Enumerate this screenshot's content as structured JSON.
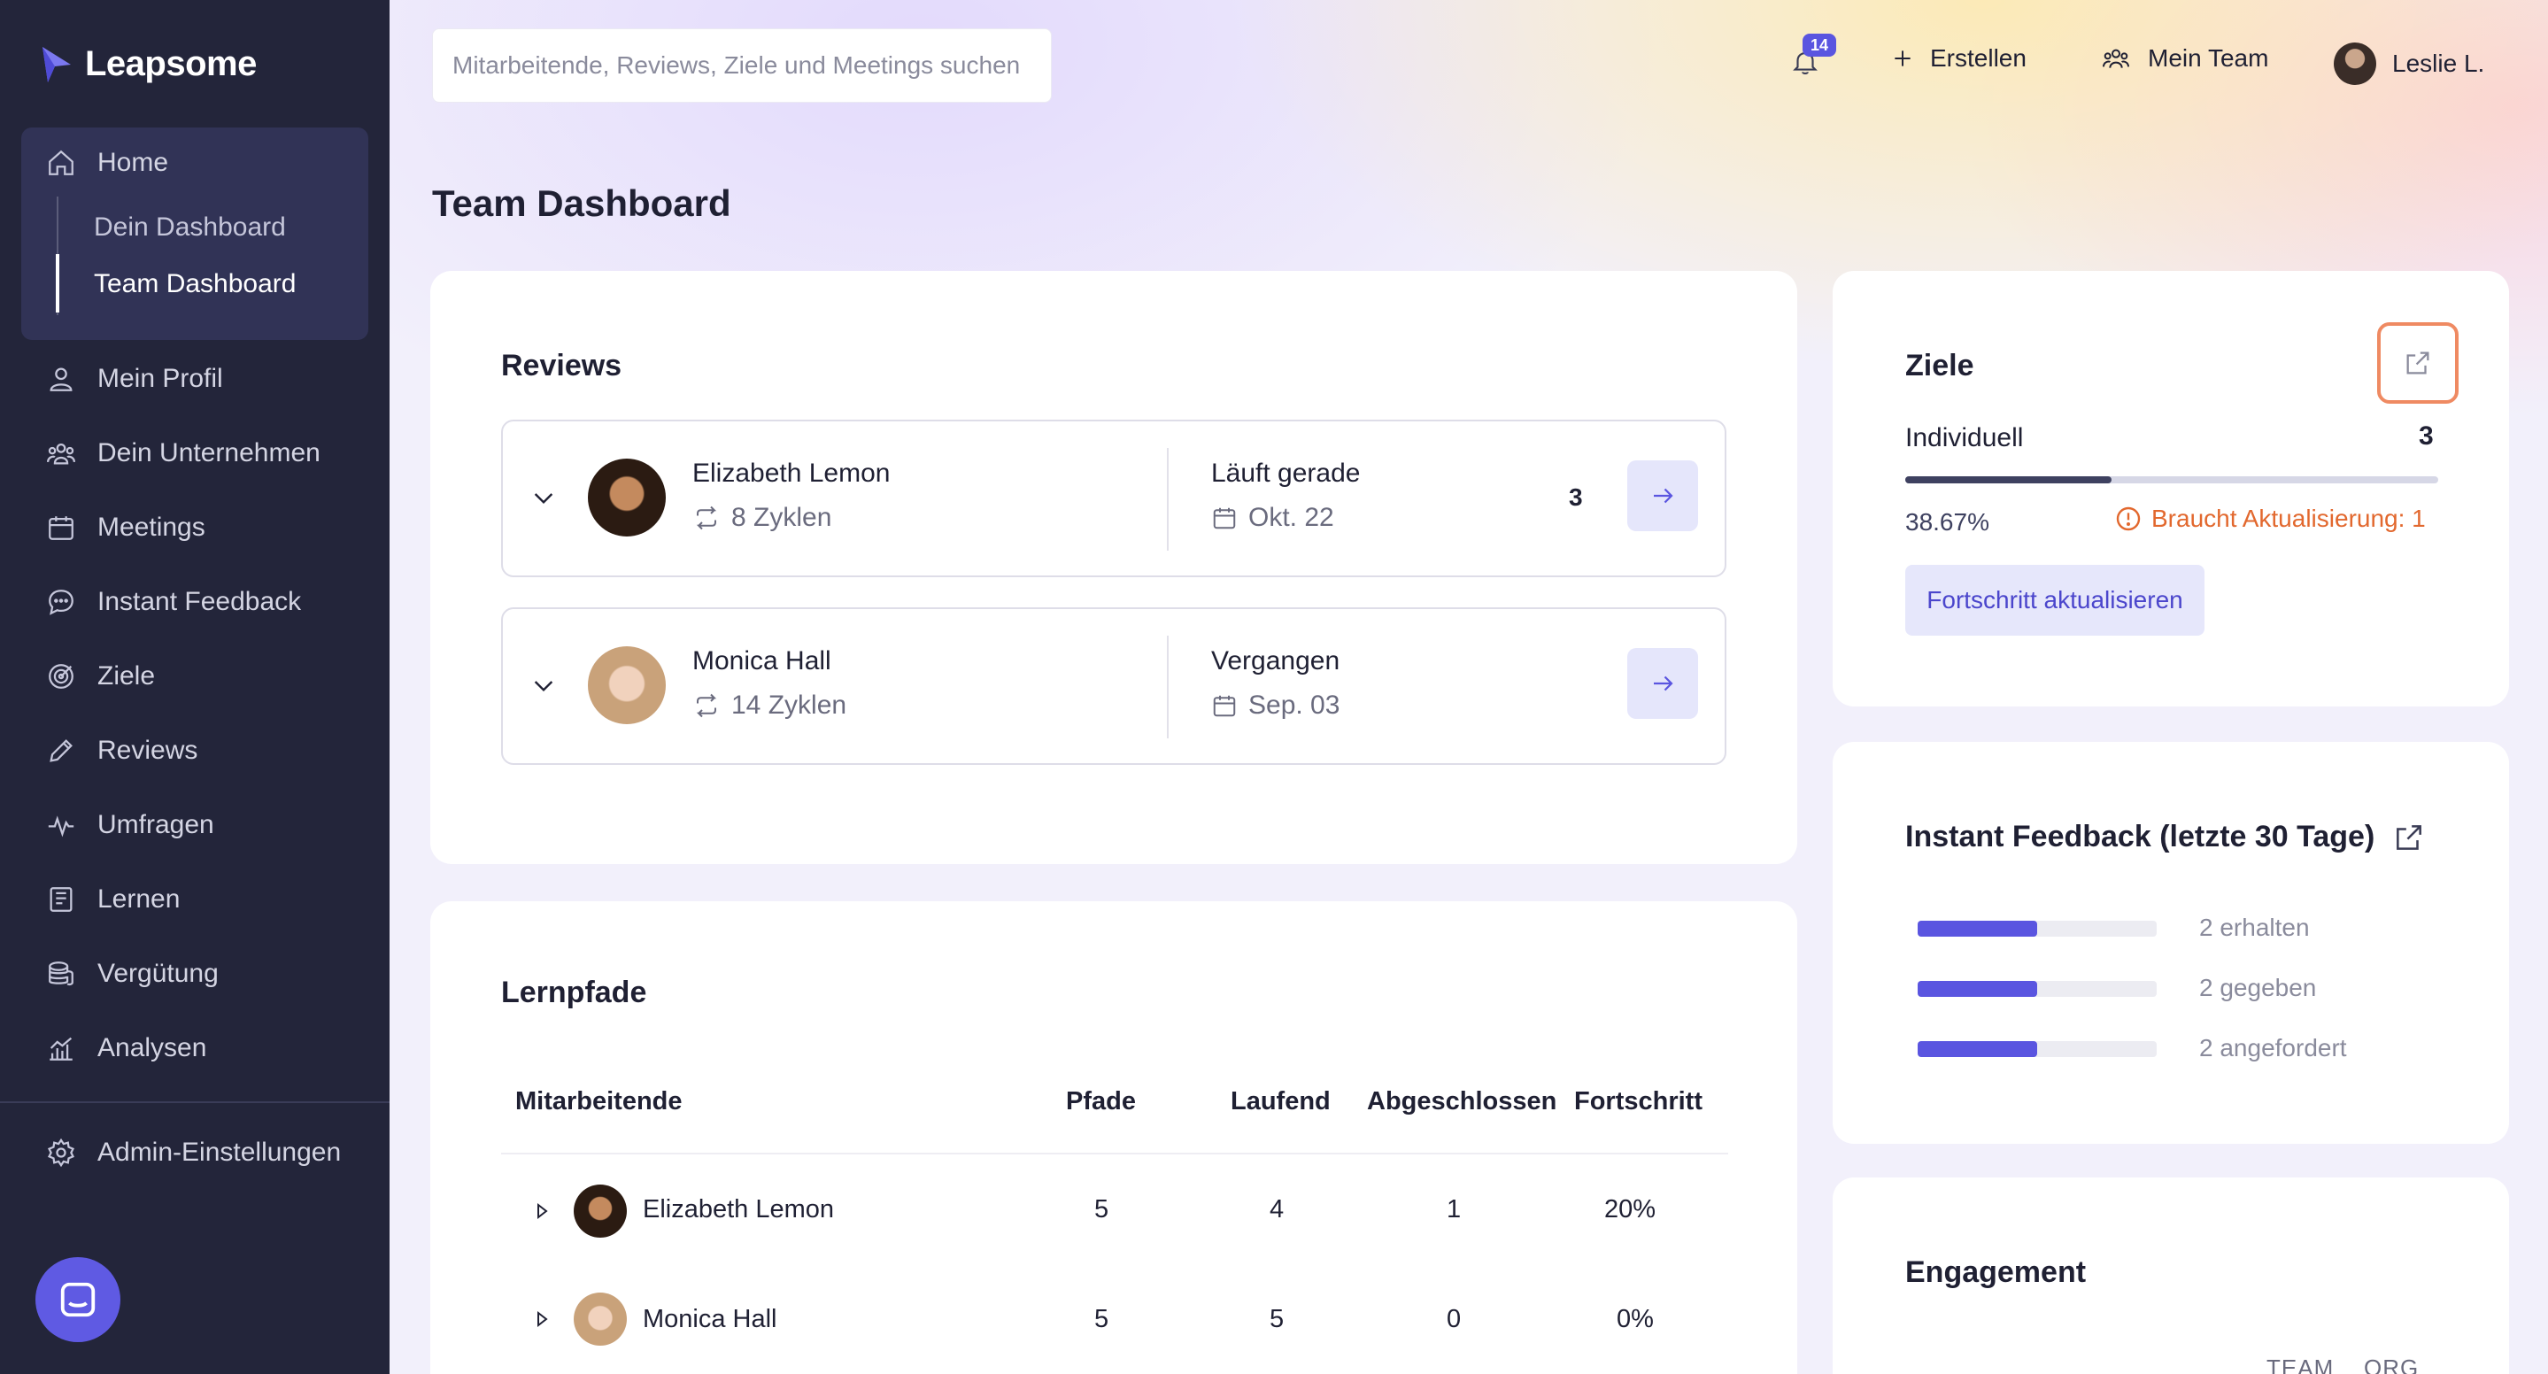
{
  "app": {
    "logo_text": "Leapsome"
  },
  "sidebar": {
    "home_label": "Home",
    "sub_items": [
      {
        "label": "Dein Dashboard"
      },
      {
        "label": "Team Dashboard"
      }
    ],
    "items": [
      {
        "label": "Mein Profil",
        "icon": "user-icon"
      },
      {
        "label": "Dein Unternehmen",
        "icon": "users-icon"
      },
      {
        "label": "Meetings",
        "icon": "calendar-icon"
      },
      {
        "label": "Instant Feedback",
        "icon": "chat-icon"
      },
      {
        "label": "Ziele",
        "icon": "target-icon"
      },
      {
        "label": "Reviews",
        "icon": "pencil-icon"
      },
      {
        "label": "Umfragen",
        "icon": "pulse-icon"
      },
      {
        "label": "Lernen",
        "icon": "book-icon"
      },
      {
        "label": "Vergütung",
        "icon": "coins-icon"
      },
      {
        "label": "Analysen",
        "icon": "chart-icon"
      }
    ],
    "admin_label": "Admin-Einstellungen"
  },
  "topbar": {
    "search_placeholder": "Mitarbeitende, Reviews, Ziele und Meetings suchen",
    "notification_count": "14",
    "create_label": "Erstellen",
    "team_label": "Mein Team",
    "user_label": "Leslie L."
  },
  "page": {
    "title": "Team Dashboard"
  },
  "reviews": {
    "title": "Reviews",
    "rows": [
      {
        "name": "Elizabeth Lemon",
        "cycles": "8 Zyklen",
        "status": "Läuft gerade",
        "date": "Okt. 22",
        "count": "3"
      },
      {
        "name": "Monica Hall",
        "cycles": "14 Zyklen",
        "status": "Vergangen",
        "date": "Sep. 03",
        "count": ""
      }
    ]
  },
  "lernpfade": {
    "title": "Lernpfade",
    "headers": [
      "Mitarbeitende",
      "Pfade",
      "Laufend",
      "Abgeschlossen",
      "Fortschritt"
    ],
    "rows": [
      {
        "name": "Elizabeth Lemon",
        "pfade": "5",
        "laufend": "4",
        "abgeschlossen": "1",
        "fortschritt": "20%"
      },
      {
        "name": "Monica Hall",
        "pfade": "5",
        "laufend": "5",
        "abgeschlossen": "0",
        "fortschritt": "0%"
      }
    ]
  },
  "ziele": {
    "title": "Ziele",
    "category": "Individuell",
    "count": "3",
    "percent": "38.67%",
    "progress": 0.3867,
    "warning": "Braucht Aktualisierung: 1",
    "button_label": "Fortschritt aktualisieren"
  },
  "instant_feedback": {
    "title": "Instant Feedback (letzte 30 Tage)",
    "rows": [
      {
        "label": "2 erhalten",
        "fraction": 0.5
      },
      {
        "label": "2 gegeben",
        "fraction": 0.5
      },
      {
        "label": "2 angefordert",
        "fraction": 0.5
      }
    ]
  },
  "engagement": {
    "title": "Engagement",
    "columns": [
      "TEAM",
      "ORG"
    ]
  },
  "colors": {
    "sidebar_bg": "#23253a",
    "accent": "#5a55e0",
    "warning": "#e2682e"
  }
}
